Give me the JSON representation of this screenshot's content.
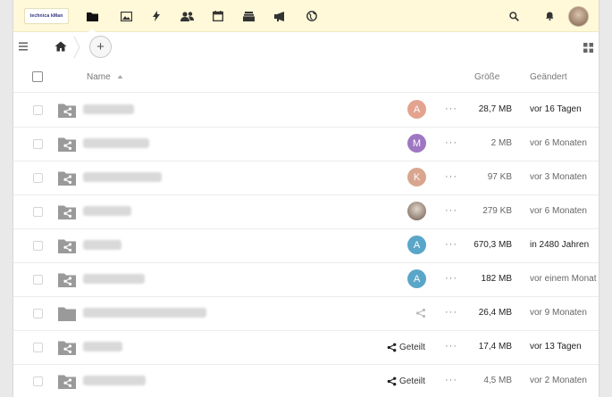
{
  "header": {
    "logo_text": "technica kMan",
    "apps": [
      {
        "icon": "folder-icon",
        "active": true
      },
      {
        "icon": "image-icon",
        "active": false
      },
      {
        "icon": "activity-icon",
        "active": false
      },
      {
        "icon": "contacts-icon",
        "active": false
      },
      {
        "icon": "calendar-icon",
        "active": false
      },
      {
        "icon": "deck-icon",
        "active": false
      },
      {
        "icon": "announcement-icon",
        "active": false
      },
      {
        "icon": "globe-icon",
        "active": false
      }
    ]
  },
  "controls": {
    "add_label": "+"
  },
  "table": {
    "col_name": "Name",
    "col_size": "Größe",
    "col_modified": "Geändert",
    "rows": [
      {
        "name": "AG_MIZ_17",
        "share": "avatar",
        "initial": "A",
        "color": "#e3a38f",
        "size": "28,7 MB",
        "modified": "vor 16 Tagen",
        "darksize": true,
        "darkmod": true
      },
      {
        "name": "BWI 2020-05-30",
        "share": "avatar",
        "initial": "M",
        "color": "#9e77c2",
        "size": "2 MB",
        "modified": "vor 6 Monaten",
        "darksize": false,
        "darkmod": false
      },
      {
        "name": "FL Urlaubsübersicht",
        "share": "avatar",
        "initial": "K",
        "color": "#d9a58f",
        "size": "97 KB",
        "modified": "vor 3 Monaten",
        "darksize": false,
        "darkmod": false
      },
      {
        "name": "Briefe 2020",
        "share": "photo",
        "initial": "",
        "color": "",
        "size": "279 KB",
        "modified": "vor 6 Monaten",
        "darksize": false,
        "darkmod": false
      },
      {
        "name": "Backend",
        "share": "avatar",
        "initial": "A",
        "color": "#5aa6c9",
        "size": "670,3 MB",
        "modified": "in 2480 Jahren",
        "darksize": true,
        "darkmod": true
      },
      {
        "name": "Backend Intern",
        "share": "avatar",
        "initial": "A",
        "color": "#5aa6c9",
        "size": "182 MB",
        "modified": "vor einem Monat",
        "darksize": true,
        "darkmod": false
      },
      {
        "name": "Backend Anhang Angebot Briefe",
        "share": "link",
        "initial": "",
        "color": "",
        "size": "26,4 MB",
        "modified": "vor 9 Monaten",
        "darksize": true,
        "darkmod": false,
        "plain": true
      },
      {
        "name": "Kalender",
        "share": "shared",
        "initial": "",
        "color": "",
        "size": "17,4 MB",
        "modified": "vor 13 Tagen",
        "darksize": true,
        "darkmod": true
      },
      {
        "name": "Kalender Intern",
        "share": "shared",
        "initial": "",
        "color": "",
        "size": "4,5 MB",
        "modified": "vor 2 Monaten",
        "darksize": false,
        "darkmod": false
      }
    ],
    "shared_label": "Geteilt",
    "more_label": "···"
  },
  "colors": {
    "header_bg": "#fff9d9",
    "folder": "#9a9a9a"
  }
}
